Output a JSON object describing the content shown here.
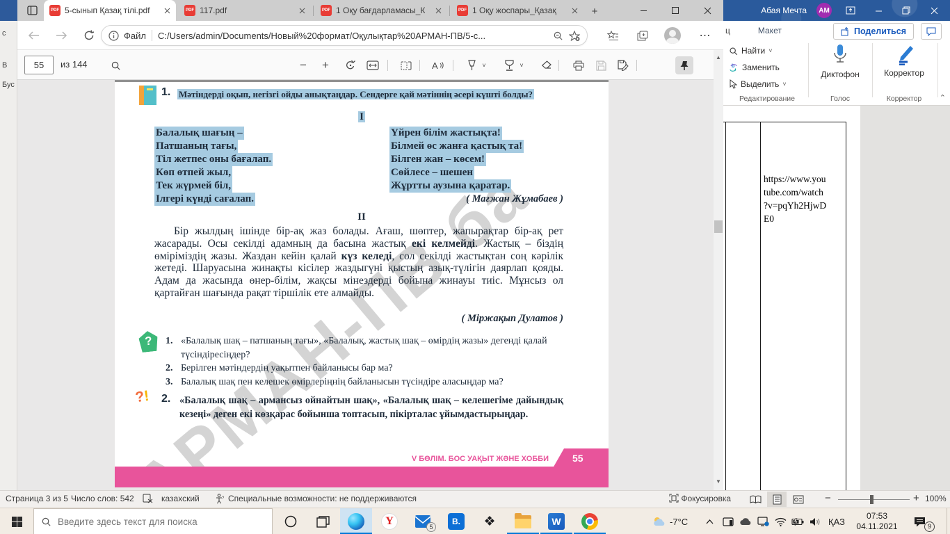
{
  "colors": {
    "highlight": "#a6cbe1",
    "pink": "#e8549b",
    "word_titlebar": "#2a5a9c",
    "accent_blue": "#0078d7",
    "word_icon_blue": "#185abd"
  },
  "leftstrip": {
    "t1": "с",
    "t2": "В",
    "t3": "Бус"
  },
  "edge": {
    "tabs": [
      {
        "title": "5-сынып Қазақ тілі.pdf"
      },
      {
        "title": "117.pdf"
      },
      {
        "title": "1 Оқу бағдарламасы_К"
      },
      {
        "title": "1 Оқу жоспары_Қазақ"
      }
    ],
    "pdf_badge": "PDF",
    "address": {
      "scheme_label": "Файл",
      "url": "C:/Users/admin/Documents/Новый%20формат/Оқулықтар%20АРМАН-ПВ/5-с..."
    },
    "pdfbar": {
      "page_value": "55",
      "page_total": "из 144"
    }
  },
  "doc": {
    "task1_no": "1.",
    "task1": "Мәтіндерді оқып, негізгі ойды анықтаңдар. Сендерге қай мәтіннің әсері күшті болды?",
    "roman1": "I",
    "poem_left": [
      "Балалық шағың –",
      "Патшаның тағы,",
      "Тіл жетпес оны бағалап.",
      "Көп өтпей жыл,",
      "Тек жүрмей біл,",
      "Ілгері күнді сағалап."
    ],
    "poem_right": [
      "Үйрен білім жастықта!",
      "Білмей өс жанға қастық та!",
      "Білген жан – көсем!",
      "Сөйлесе – шешен",
      "Жұртты аузына қаратар."
    ],
    "author1": "( Мағжан Жұмабаев )",
    "roman2": "II",
    "para": {
      "p1": "Бір жылдың ішінде бір-ақ жаз болады. Ағаш, шөптер, жапырақтар бір-ақ рет жасарады. Осы секілді адамның да басына жастық ",
      "b1": "екі келмейді",
      "p2": ". Жастық – біздің өміріміздің жазы. Жаздан кейін қалай ",
      "b2": "күз келеді",
      "p3": ", сол секілді жастықтан соң кәрілік жетеді. Шаруасына жинақты кісілер жаздыгүні қыстың азық-түлігін даярлап қояды. Адам да жасында өнер-білім, жақсы мінездерді бойына жинауы тиіс. Мұнсыз ол қартайған шағында рақат тіршілік ете алмайды."
    },
    "author2": "( Міржақып Дулатов )",
    "questions": [
      {
        "no": "1.",
        "text": "«Балалық шақ – патшаның тағы», «Балалық, жастық шақ – өмірдің жазы» дегенді қалай түсіндіресіңдер?"
      },
      {
        "no": "2.",
        "text": "Берілген мәтіндердің уақытпен байланысы бар ма?"
      },
      {
        "no": "3.",
        "text": "Балалық шақ пен келешек өмірлеріңнің байланысын түсіндіре аласыңдар ма?"
      }
    ],
    "task2_no": "2.",
    "task2": "«Балалық шақ – армансыз ойнайтын шақ», «Балалық шақ – келешегіме дайындық кезеңі» деген екі көзқарас бойынша топтасып, пікірталас ұйымдастырыңдар.",
    "footer_section": "V БӨЛІМ. БОС УАҚЫТ ЖӘНЕ ХОББИ",
    "footer_page": "55",
    "watermark": "АРМАН-ПВ ба"
  },
  "word": {
    "user": "Абая Мечта",
    "avatar": "AM",
    "tab_partial": "ц",
    "tab_layout": "Макет",
    "share": "Поделиться",
    "find": "Найти",
    "replace": "Заменить",
    "select": "Выделить",
    "grp_editing": "Редактирование",
    "dictate": "Диктофон",
    "grp_voice": "Голос",
    "editor": "Корректор",
    "grp_editor": "Корректор",
    "doc_lines": [
      "https://www.you",
      "tube.com/watch",
      "?v=pqYh2HjwD",
      "E0"
    ],
    "status": {
      "page": "Страница 3 из 5",
      "words": "Число слов: 542",
      "lang": "казахский",
      "accessibility": "Специальные возможности: не поддерживаются",
      "focus": "Фокусировка",
      "zoom": "100%"
    }
  },
  "taskbar": {
    "search_placeholder": "Введите здесь текст для поиска",
    "vk": "B.",
    "mail_badge": "5",
    "tray": {
      "temp": "-7°C",
      "lang": "ҚАЗ",
      "time": "07:53",
      "date": "04.11.2021",
      "notif_badge": "9"
    }
  }
}
